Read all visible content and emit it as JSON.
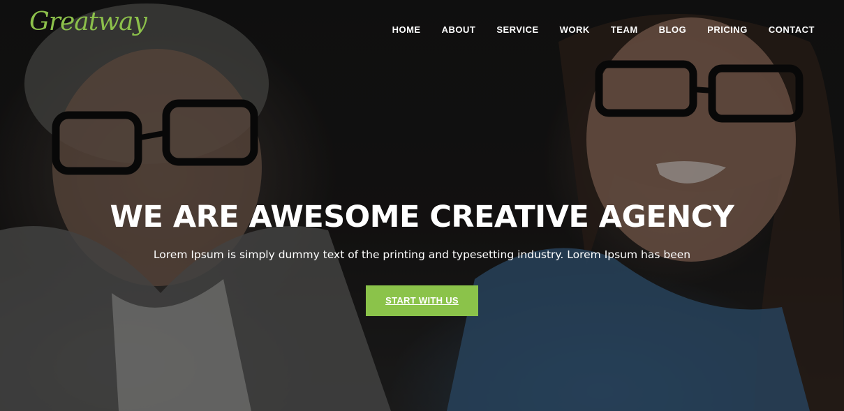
{
  "brand": {
    "logo_text": "Greatway",
    "accent_color": "#8bc34a"
  },
  "nav": {
    "items": [
      {
        "label": "HOME"
      },
      {
        "label": "ABOUT"
      },
      {
        "label": "SERVICE"
      },
      {
        "label": "WORK"
      },
      {
        "label": "TEAM"
      },
      {
        "label": "BLOG"
      },
      {
        "label": "PRICING"
      },
      {
        "label": "CONTACT"
      }
    ]
  },
  "hero": {
    "title": "WE ARE AWESOME CREATIVE AGENCY",
    "subtitle": "Lorem Ipsum is simply dummy text of the printing and typesetting industry. Lorem Ipsum has been",
    "cta_label": "START WITH US"
  }
}
